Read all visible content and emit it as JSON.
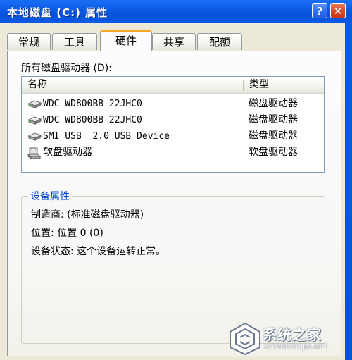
{
  "window": {
    "title": "本地磁盘 (C:) 属性",
    "help_label": "?",
    "close_label": "✕"
  },
  "tabs": [
    {
      "label": "常规"
    },
    {
      "label": "工具"
    },
    {
      "label": "硬件",
      "active": true
    },
    {
      "label": "共享"
    },
    {
      "label": "配额"
    }
  ],
  "hardware": {
    "section_label": "所有磁盘驱动器 (D):",
    "columns": {
      "name": "名称",
      "type": "类型"
    },
    "devices": [
      {
        "name": "WDC WD800BB-22JHC0",
        "type": "磁盘驱动器",
        "icon": "hard-disk-icon"
      },
      {
        "name": "WDC WD800BB-22JHC0",
        "type": "磁盘驱动器",
        "icon": "hard-disk-icon"
      },
      {
        "name": "SMI USB  2.0 USB Device",
        "type": "磁盘驱动器",
        "icon": "hard-disk-icon"
      },
      {
        "name": "软盘驱动器",
        "type": "软盘驱动器",
        "icon": "floppy-drive-icon"
      }
    ],
    "properties": {
      "group_title": "设备属性",
      "manufacturer": "制造商: (标准磁盘驱动器)",
      "location": "位置: 位置 0 (0)",
      "status": "设备状态: 这个设备运转正常。"
    }
  },
  "watermark": {
    "title": "系统之家",
    "url": "XITONGZHIJIA.NET"
  },
  "colors": {
    "titlebar": "#0a5ae6",
    "tab_highlight": "#f5a623",
    "group_title": "#0046d5"
  }
}
